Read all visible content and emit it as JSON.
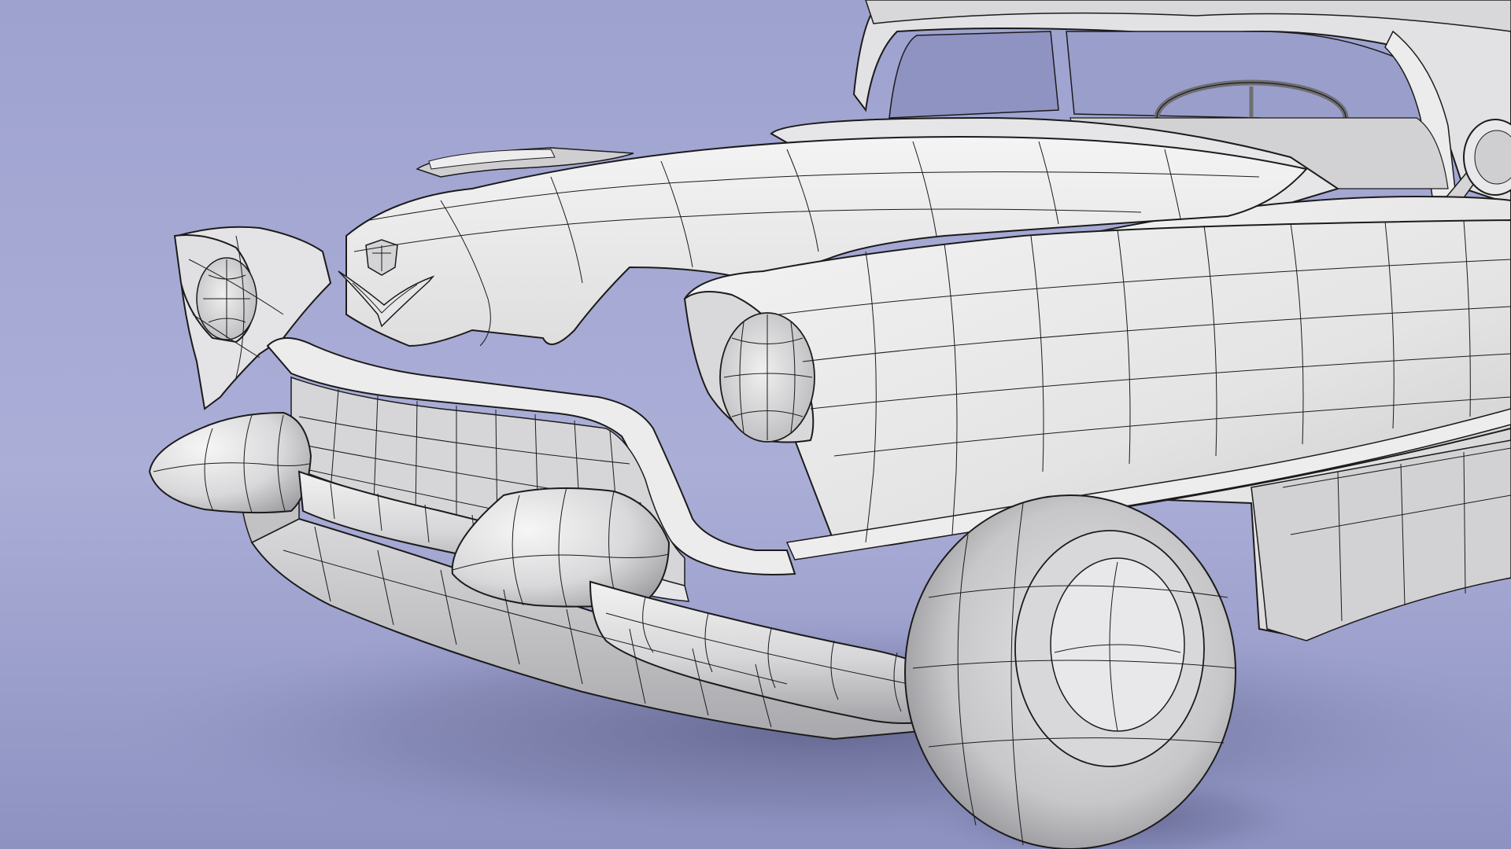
{
  "image": {
    "subject": "",
    "colors": {
      "backdrop_top": "#9fa3d0",
      "backdrop_mid": "#a9acd6",
      "backdrop_bottom": "#8f93c2",
      "floor_shadow": "#6f739d",
      "body_light": "#f1f1f1",
      "body_mid": "#dcdcdc",
      "body_shade": "#b9b9bb",
      "body_dark": "#8c8c90",
      "wire": "#1b1b1b",
      "tire": "#d0d0d2",
      "tire_dark": "#9b9b9f"
    }
  }
}
